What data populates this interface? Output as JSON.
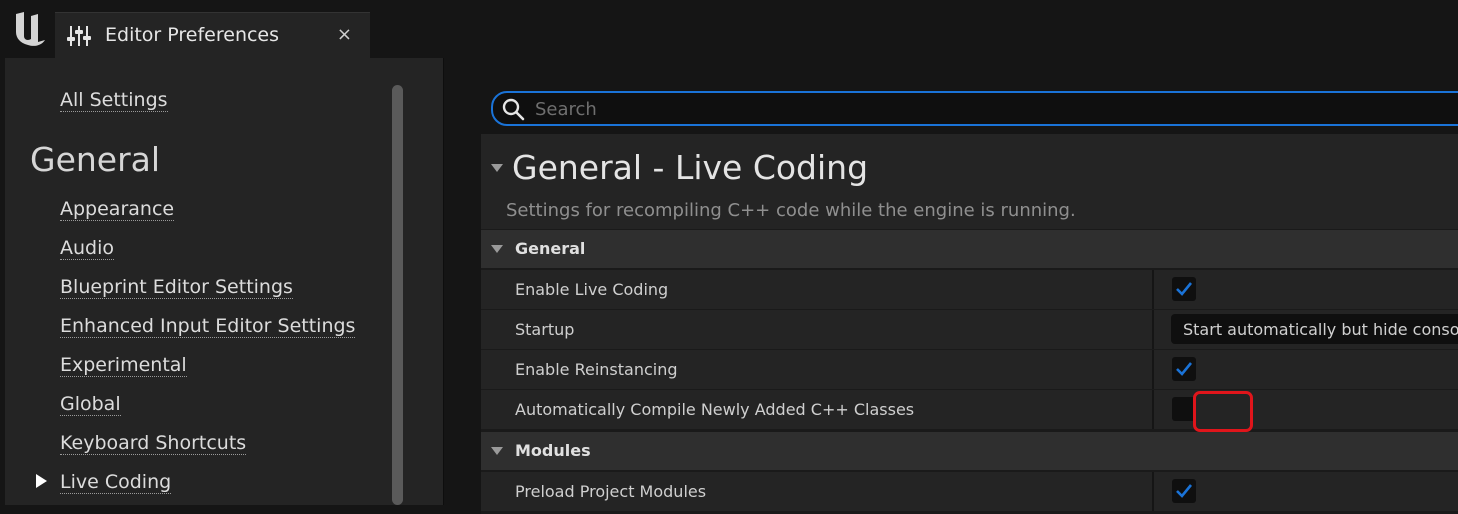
{
  "titlebar": {
    "app_logo": "unreal-engine-logo",
    "tab_title": "Editor Preferences",
    "tab_icon": "sliders-icon",
    "close_glyph": "×"
  },
  "sidebar": {
    "all_settings": "All Settings",
    "heading": "General",
    "items": [
      {
        "label": "Appearance"
      },
      {
        "label": "Audio"
      },
      {
        "label": "Blueprint Editor Settings"
      },
      {
        "label": "Enhanced Input Editor Settings"
      },
      {
        "label": "Experimental"
      },
      {
        "label": "Global"
      },
      {
        "label": "Keyboard Shortcuts"
      },
      {
        "label": "Live Coding",
        "selected": true
      }
    ]
  },
  "search": {
    "placeholder": "Search",
    "value": ""
  },
  "section": {
    "title": "General - Live Coding",
    "description": "Settings for recompiling C++ code while the engine is running."
  },
  "categories": [
    {
      "label": "General",
      "properties": [
        {
          "name": "Enable Live Coding",
          "type": "checkbox",
          "checked": true
        },
        {
          "name": "Startup",
          "type": "combo",
          "value": "Start automatically but hide console until needed"
        },
        {
          "name": "Enable Reinstancing",
          "type": "checkbox",
          "checked": true
        },
        {
          "name": "Automatically Compile Newly Added C++ Classes",
          "type": "checkbox",
          "checked": false,
          "highlighted": true
        }
      ]
    },
    {
      "label": "Modules",
      "properties": [
        {
          "name": "Preload Project Modules",
          "type": "checkbox",
          "checked": true
        }
      ]
    }
  ],
  "colors": {
    "accent": "#1a73d8",
    "highlight": "#e0151b",
    "background": "#151515",
    "panel": "#242424"
  }
}
